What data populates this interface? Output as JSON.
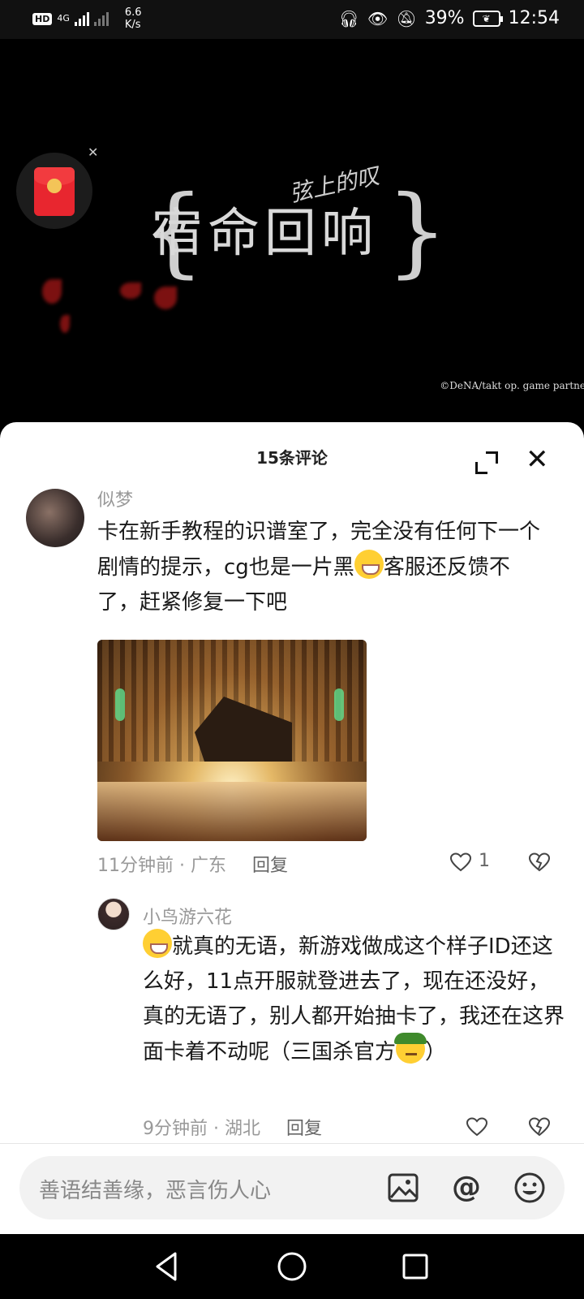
{
  "status_bar": {
    "hd_badge": "HD",
    "network": "4G",
    "speed_value": "6.6",
    "speed_unit": "K/s",
    "battery": "39%",
    "time": "12:54"
  },
  "video": {
    "logo_main": "宿命回响",
    "logo_sub": "弦上的叹",
    "copyright": "©DeNA/takt op. game partne"
  },
  "comments_sheet": {
    "title": "15条评论",
    "comments": [
      {
        "username": "似梦",
        "text_before_emoji": "卡在新手教程的识谱室了，完全没有任何下一个剧情的提示，cg也是一片黑",
        "text_after_emoji": "客服还反馈不了，赶紧修复一下吧",
        "time": "11分钟前",
        "location": "广东",
        "reply_label": "回复",
        "like_count": "1"
      },
      {
        "username": "小鸟游六花",
        "text_main": "就真的无语，新游戏做成这个样子ID还这么好，11点开服就登进去了，现在还没好，真的无语了，别人都开始抽卡了，我还在这界面卡着不动呢（三国杀官方",
        "text_end": "）",
        "time": "9分钟前",
        "location": "湖北",
        "reply_label": "回复"
      }
    ]
  },
  "input": {
    "placeholder": "善语结善缘，恶言伤人心"
  }
}
